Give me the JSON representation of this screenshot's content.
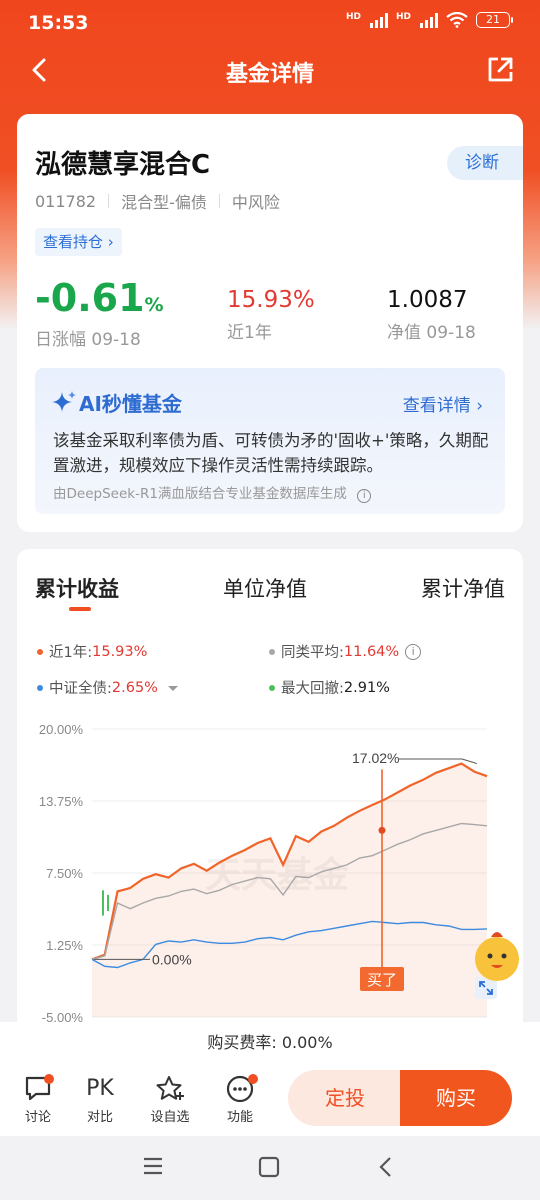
{
  "status_bar": {
    "time": "15:53",
    "battery": "21"
  },
  "nav": {
    "title": "基金详情"
  },
  "fund": {
    "name": "泓德慧享混合C",
    "diagnose_label": "诊断",
    "code": "011782",
    "type": "混合型-偏债",
    "risk": "中风险",
    "holdings_label": "查看持仓 ›",
    "daily_change": "-0.61",
    "daily_change_unit": "%",
    "daily_label": "日涨幅 09-18",
    "year_return": "15.93%",
    "year_label": "近1年",
    "nav_value": "1.0087",
    "nav_label": "净值 09-18"
  },
  "ai": {
    "title": "AI秒懂基金",
    "detail_label": "查看详情 ›",
    "text": "该基金采取利率债为盾、可转债为矛的'固收+'策略，久期配置激进，规模效应下操作灵活性需持续跟踪。",
    "source": "由DeepSeek-R1满血版结合专业基金数据库生成"
  },
  "chart_tabs": [
    "累计收益",
    "单位净值",
    "累计净值"
  ],
  "legend": {
    "fund": {
      "label": "近1年:",
      "value": "15.93%"
    },
    "peer": {
      "label": "同类平均:",
      "value": "11.64%"
    },
    "index": {
      "label": "中证全债:",
      "value": "2.65%"
    },
    "drawdown": {
      "label": "最大回撤:",
      "value": "2.91%"
    }
  },
  "colors": {
    "fund": "#f0642a",
    "peer": "#a8a8a8",
    "index": "#3d8be0",
    "drawdown": "#4cc05c",
    "accent": "#f04f24"
  },
  "chart_data": {
    "type": "line",
    "y_ticks": [
      "20.00%",
      "13.75%",
      "7.50%",
      "1.25%",
      "-5.00%"
    ],
    "ylim": [
      -5,
      20
    ],
    "watermark": "天天基金",
    "annotations": {
      "peak_label": "17.02%",
      "start_label": "0.00%",
      "buy_label": "买了"
    },
    "series": [
      {
        "name": "近1年",
        "values": [
          0,
          0.4,
          5.9,
          6.2,
          7.0,
          7.4,
          7.1,
          7.9,
          8.3,
          7.7,
          8.4,
          9.0,
          9.5,
          10.1,
          10.5,
          8.2,
          10.7,
          10.2,
          11.1,
          11.6,
          12.3,
          12.9,
          13.4,
          13.9,
          14.5,
          15.1,
          15.6,
          16.2,
          16.6,
          17.0,
          16.3,
          15.9
        ]
      },
      {
        "name": "同类平均",
        "values": [
          0,
          0.3,
          4.9,
          4.4,
          4.9,
          5.3,
          5.5,
          5.9,
          6.1,
          5.7,
          6.0,
          6.5,
          6.8,
          7.1,
          7.0,
          5.6,
          7.2,
          7.1,
          7.6,
          7.9,
          8.2,
          8.8,
          9.0,
          9.5,
          10.0,
          10.4,
          10.9,
          11.2,
          11.5,
          11.8,
          11.7,
          11.6
        ]
      },
      {
        "name": "中证全债",
        "values": [
          0,
          -0.6,
          -0.7,
          -0.3,
          0.0,
          1.3,
          1.6,
          1.5,
          1.7,
          1.5,
          1.4,
          1.4,
          1.5,
          1.8,
          1.9,
          1.7,
          2.1,
          2.4,
          2.5,
          2.7,
          2.9,
          3.1,
          3.3,
          3.2,
          3.1,
          3.2,
          3.2,
          3.0,
          2.9,
          2.6,
          2.6,
          2.65
        ]
      }
    ]
  },
  "fee": {
    "label": "购买费率: 0.00%"
  },
  "bottom": {
    "discuss": "讨论",
    "pk_icon": "PK",
    "compare": "对比",
    "watchlist": "设自选",
    "functions": "功能",
    "plan": "定投",
    "buy": "购买"
  }
}
